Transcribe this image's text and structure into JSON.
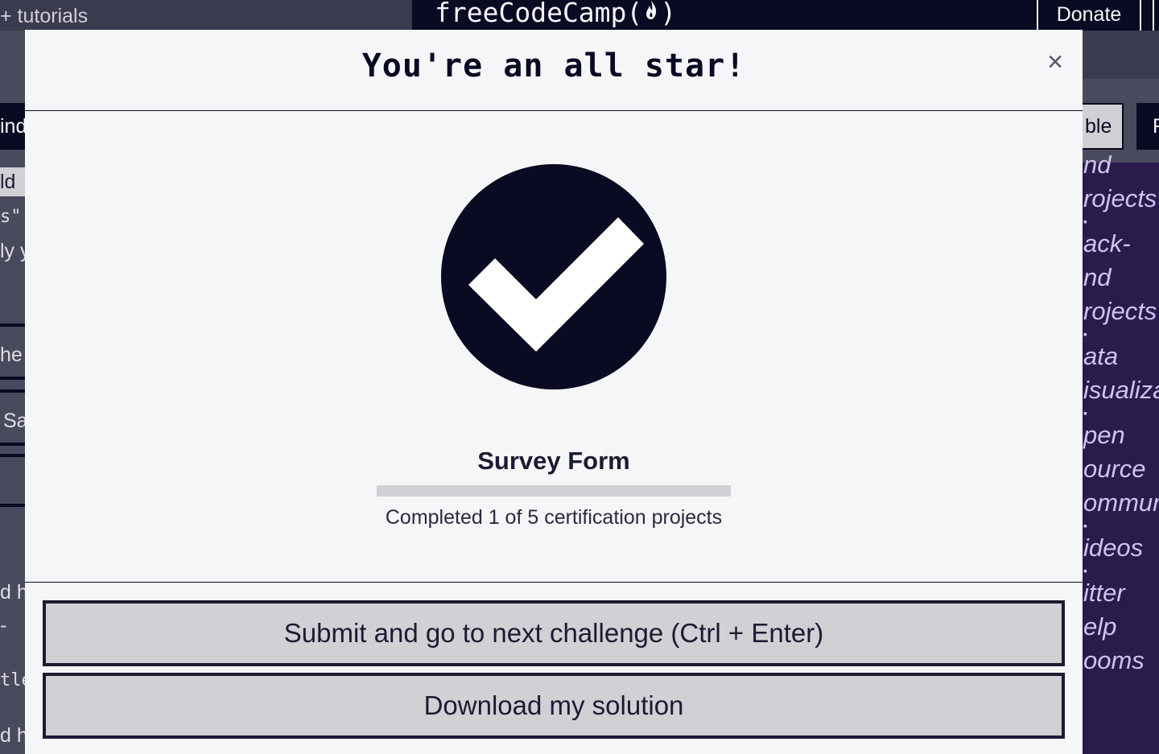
{
  "nav": {
    "search_text": "+ tutorials",
    "logo_text": "freeCodeCamp",
    "logo_paren_open": "(",
    "logo_paren_close": ")",
    "donate_label": "Donate"
  },
  "background_left": {
    "fragments": [
      "ind",
      "ld",
      "s\":",
      "ly y",
      "he",
      "Sa",
      "d h",
      "-",
      "tle",
      "d h"
    ]
  },
  "background_right": {
    "button_a": "ble",
    "button_b": "F",
    "links": [
      "nd",
      "rojects",
      "ack-",
      "nd",
      "rojects",
      "ata",
      "isualiza",
      "pen",
      "ource",
      "ommun",
      "ideos",
      "itter",
      "elp",
      "ooms"
    ]
  },
  "modal": {
    "title": "You're an all star!",
    "close_label": "×",
    "project_title": "Survey Form",
    "progress": {
      "completed": 1,
      "total": 5,
      "fraction": 0.2,
      "text": "Completed 1 of 5 certification projects"
    },
    "submit_label": "Submit and go to next challenge (Ctrl + Enter)",
    "download_label": "Download my solution"
  },
  "colors": {
    "nav_background": "#0a0a23",
    "modal_background": "#f5f6f7",
    "button_background": "#d0d0d5",
    "button_border": "#1b1b32",
    "checkmark_circle": "#0a0a23",
    "sidebar_purple": "#2a1b4d"
  },
  "icons": {
    "success": "checkmark-circle-icon",
    "close": "close-icon",
    "logo": "flame-icon"
  }
}
